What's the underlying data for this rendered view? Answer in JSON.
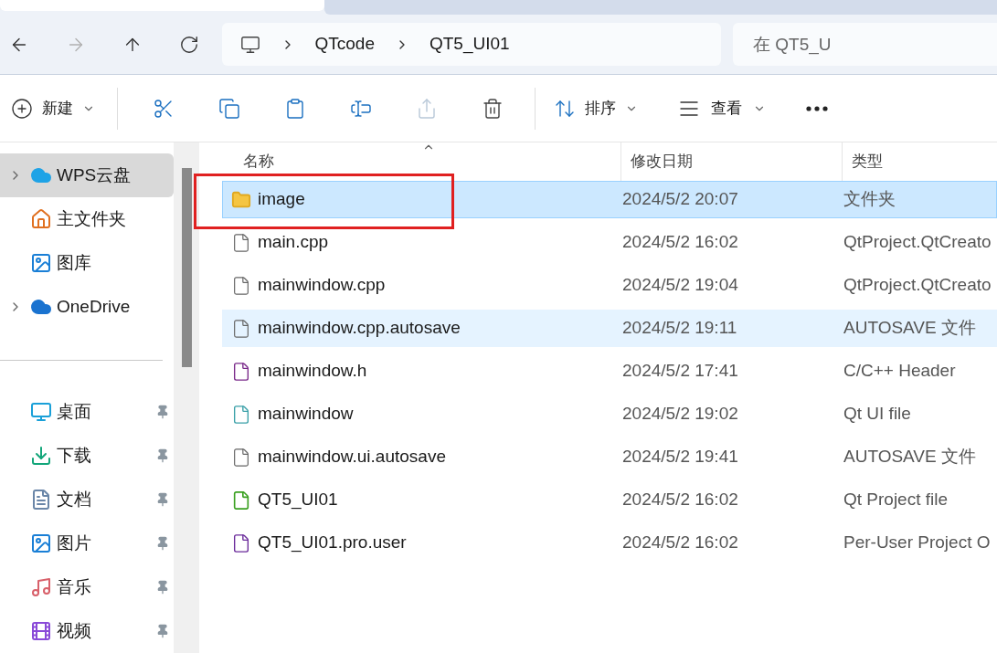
{
  "nav": {
    "buttons": [
      {
        "kind": "back",
        "disabled": false
      },
      {
        "kind": "forward",
        "disabled": true
      },
      {
        "kind": "up",
        "disabled": false
      },
      {
        "kind": "refresh",
        "disabled": false
      }
    ],
    "breadcrumb": [
      "QTcode",
      "QT5_UI01"
    ],
    "search": {
      "placeholder": "在 QT5_U"
    }
  },
  "toolbar": {
    "new": "新建",
    "tools": [
      {
        "kind": "cut",
        "disabled": false
      },
      {
        "kind": "copy",
        "disabled": false
      },
      {
        "kind": "paste",
        "disabled": false
      },
      {
        "kind": "rename",
        "disabled": false
      },
      {
        "kind": "share",
        "disabled": true
      },
      {
        "kind": "delete",
        "disabled": false
      }
    ],
    "sort": "排序",
    "view": "查看"
  },
  "sidebar": {
    "top": [
      {
        "kind": "cloud-wps",
        "label": "WPS云盘",
        "expandable": true,
        "selected": true
      },
      {
        "kind": "home",
        "label": "主文件夹",
        "expandable": false,
        "selected": false
      },
      {
        "kind": "gallery",
        "label": "图库",
        "expandable": false,
        "selected": false
      },
      {
        "kind": "cloud",
        "label": "OneDrive",
        "expandable": true,
        "selected": false
      }
    ],
    "pinned": [
      {
        "kind": "desktop",
        "label": "桌面",
        "pinned": true
      },
      {
        "kind": "download",
        "label": "下载",
        "pinned": true
      },
      {
        "kind": "document",
        "label": "文档",
        "pinned": true
      },
      {
        "kind": "picture",
        "label": "图片",
        "pinned": true
      },
      {
        "kind": "music",
        "label": "音乐",
        "pinned": true
      },
      {
        "kind": "video",
        "label": "视频",
        "pinned": true
      }
    ]
  },
  "table": {
    "columns": [
      "名称",
      "修改日期",
      "类型"
    ],
    "rows": [
      {
        "kind": "folder",
        "name": "image",
        "date": "2024/5/2 20:07",
        "type": "文件夹",
        "selected": true,
        "hovered": false,
        "annotated": true
      },
      {
        "kind": "file",
        "name": "main.cpp",
        "date": "2024/5/2 16:02",
        "type": "QtProject.QtCreato",
        "selected": false,
        "hovered": false,
        "annotated": false
      },
      {
        "kind": "file",
        "name": "mainwindow.cpp",
        "date": "2024/5/2 19:04",
        "type": "QtProject.QtCreato",
        "selected": false,
        "hovered": false,
        "annotated": false
      },
      {
        "kind": "file",
        "name": "mainwindow.cpp.autosave",
        "date": "2024/5/2 19:11",
        "type": "AUTOSAVE 文件",
        "selected": false,
        "hovered": true,
        "annotated": false
      },
      {
        "kind": "header",
        "name": "mainwindow.h",
        "date": "2024/5/2 17:41",
        "type": "C/C++ Header",
        "selected": false,
        "hovered": false,
        "annotated": false
      },
      {
        "kind": "ui",
        "name": "mainwindow",
        "date": "2024/5/2 19:02",
        "type": "Qt UI file",
        "selected": false,
        "hovered": false,
        "annotated": false
      },
      {
        "kind": "file",
        "name": "mainwindow.ui.autosave",
        "date": "2024/5/2 19:41",
        "type": "AUTOSAVE 文件",
        "selected": false,
        "hovered": false,
        "annotated": false
      },
      {
        "kind": "pro",
        "name": "QT5_UI01",
        "date": "2024/5/2 16:02",
        "type": "Qt Project file",
        "selected": false,
        "hovered": false,
        "annotated": false
      },
      {
        "kind": "user",
        "name": "QT5_UI01.pro.user",
        "date": "2024/5/2 16:02",
        "type": "Per-User Project O",
        "selected": false,
        "hovered": false,
        "annotated": false
      }
    ]
  }
}
